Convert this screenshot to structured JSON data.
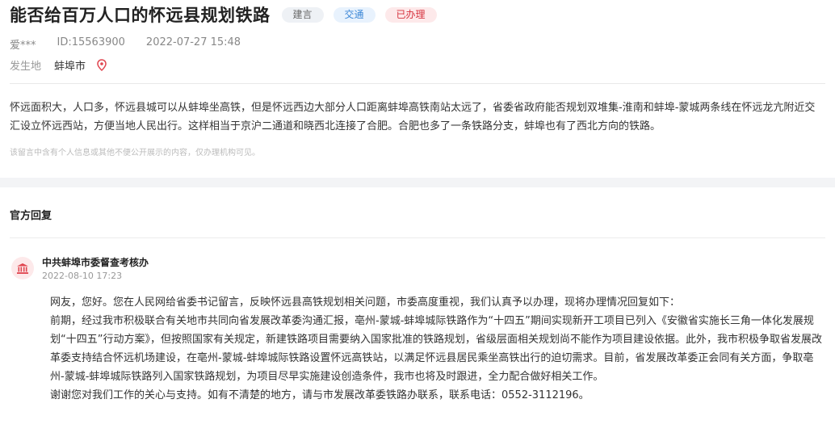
{
  "post": {
    "title": "能否给百万人口的怀远县规划铁路",
    "tags": [
      "建言",
      "交通",
      "已办理"
    ],
    "user": "爱***",
    "id": "ID:15563900",
    "datetime": "2022-07-27 15:48",
    "location_label": "发生地",
    "location": "蚌埠市",
    "content": "怀远面积大，人口多，怀远县城可以从蚌埠坐高铁，但是怀远西边大部分人口距离蚌埠高铁南站太远了，省委省政府能否规划双堆集-淮南和蚌埠-蒙城两条线在怀远龙亢附近交汇设立怀远西站，方便当地人民出行。这样相当于京沪二通道和晓西北连接了合肥。合肥也多了一条铁路分支，蚌埠也有了西北方向的铁路。",
    "notice": "该留言中含有个人信息或其他不便公开展示的内容，仅办理机构可见。"
  },
  "reply": {
    "section_title": "官方回复",
    "org": "中共蚌埠市委督查考核办",
    "datetime": "2022-08-10 17:23",
    "paragraphs": [
      "网友，您好。您在人民网给省委书记留言，反映怀远县高铁规划相关问题，市委高度重视，我们认真予以办理，现将办理情况回复如下：",
      "前期，经过我市积极联合有关地市共同向省发展改革委沟通汇报，亳州-蒙城-蚌埠城际铁路作为“十四五”期间实现新开工项目已列入《安徽省实施长三角一体化发展规划“十四五”行动方案》，但按照国家有关规定，新建铁路项目需要纳入国家批准的铁路规划，省级层面相关规划尚不能作为项目建设依据。此外，我市积极争取省发展改革委支持结合怀远机场建设，在亳州-蒙城-蚌埠城际铁路设置怀远高铁站，以满足怀远县居民乘坐高铁出行的迫切需求。目前，省发展改革委正会同有关方面，争取亳州-蒙城-蚌埠城际铁路列入国家铁路规划，为项目尽早实施建设创造条件，我市也将及时跟进，全力配合做好相关工作。",
      "谢谢您对我们工作的关心与支持。如有不清楚的地方，请与市发展改革委铁路办联系，联系电话：0552-3112196。"
    ]
  },
  "icons": {
    "location": "location-pin-icon",
    "org": "government-building-icon"
  },
  "colors": {
    "accent_red": "#d6333f",
    "accent_blue": "#3a86d6"
  }
}
